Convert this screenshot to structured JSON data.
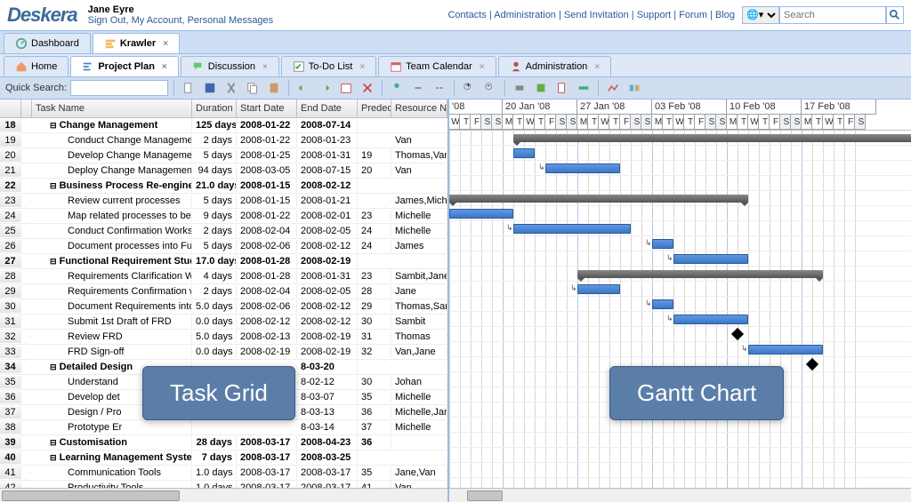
{
  "header": {
    "logo": "Deskera",
    "user_name": "Jane Eyre",
    "user_links": [
      "Sign Out",
      "My Account",
      "Personal Messages"
    ],
    "top_links": [
      "Contacts",
      "Administration",
      "Send Invitation",
      "Support",
      "Forum",
      "Blog"
    ],
    "search_placeholder": "Search"
  },
  "module_tabs": [
    {
      "label": "Dashboard",
      "active": false
    },
    {
      "label": "Krawler",
      "active": true
    }
  ],
  "sub_tabs": [
    {
      "label": "Home"
    },
    {
      "label": "Project Plan",
      "active": true
    },
    {
      "label": "Discussion"
    },
    {
      "label": "To-Do List"
    },
    {
      "label": "Team Calendar"
    },
    {
      "label": "Administration"
    }
  ],
  "quick_search_label": "Quick Search:",
  "grid_headers": {
    "task": "Task Name",
    "duration": "Duration",
    "start": "Start Date",
    "end": "End Date",
    "pred": "Predec",
    "res": "Resource Names"
  },
  "tasks": [
    {
      "n": 18,
      "lvl": 1,
      "sum": true,
      "name": "Change Management",
      "dur": "125 days",
      "s": "2008-01-22",
      "e": "2008-07-14",
      "p": "",
      "r": ""
    },
    {
      "n": 19,
      "lvl": 2,
      "name": "Conduct Change Management Plan",
      "dur": "2 days",
      "s": "2008-01-22",
      "e": "2008-01-23",
      "p": "",
      "r": "Van"
    },
    {
      "n": 20,
      "lvl": 2,
      "name": "Develop Change Management Plan",
      "dur": "5 days",
      "s": "2008-01-25",
      "e": "2008-01-31",
      "p": "19",
      "r": "Thomas,Van"
    },
    {
      "n": 21,
      "lvl": 2,
      "name": "Deploy Change Management Act",
      "dur": "94 days",
      "s": "2008-03-05",
      "e": "2008-07-15",
      "p": "20",
      "r": "Van"
    },
    {
      "n": 22,
      "lvl": 1,
      "sum": true,
      "name": "Business Process Re-engineering",
      "dur": "21.0 days",
      "s": "2008-01-15",
      "e": "2008-02-12",
      "p": "",
      "r": ""
    },
    {
      "n": 23,
      "lvl": 2,
      "name": "Review current processes",
      "dur": "5 days",
      "s": "2008-01-15",
      "e": "2008-01-21",
      "p": "",
      "r": "James,Michelle"
    },
    {
      "n": 24,
      "lvl": 2,
      "name": "Map related processes to best p",
      "dur": "9 days",
      "s": "2008-01-22",
      "e": "2008-02-01",
      "p": "23",
      "r": "Michelle"
    },
    {
      "n": 25,
      "lvl": 2,
      "name": "Conduct Confirmation Workshop",
      "dur": "2 days",
      "s": "2008-02-04",
      "e": "2008-02-05",
      "p": "24",
      "r": "Michelle"
    },
    {
      "n": 26,
      "lvl": 2,
      "name": "Document processes into Functi",
      "dur": "5 days",
      "s": "2008-02-06",
      "e": "2008-02-12",
      "p": "24",
      "r": "James"
    },
    {
      "n": 27,
      "lvl": 1,
      "sum": true,
      "name": "Functional Requirement Study",
      "dur": "17.0 days",
      "s": "2008-01-28",
      "e": "2008-02-19",
      "p": "",
      "r": ""
    },
    {
      "n": 28,
      "lvl": 2,
      "name": "Requirements Clarification Works",
      "dur": "4 days",
      "s": "2008-01-28",
      "e": "2008-01-31",
      "p": "23",
      "r": "Sambit,Jane"
    },
    {
      "n": 29,
      "lvl": 2,
      "name": "Requirements Confirmation work",
      "dur": "2 days",
      "s": "2008-02-04",
      "e": "2008-02-05",
      "p": "28",
      "r": "Jane"
    },
    {
      "n": 30,
      "lvl": 2,
      "name": "Document Requirements into FRD",
      "dur": "5.0 days",
      "s": "2008-02-06",
      "e": "2008-02-12",
      "p": "29",
      "r": "Thomas,Sambit"
    },
    {
      "n": 31,
      "lvl": 2,
      "name": "Submit 1st Draft of FRD",
      "dur": "0.0 days",
      "s": "2008-02-12",
      "e": "2008-02-12",
      "p": "30",
      "r": "Sambit"
    },
    {
      "n": 32,
      "lvl": 2,
      "name": "Review FRD",
      "dur": "5.0 days",
      "s": "2008-02-13",
      "e": "2008-02-19",
      "p": "31",
      "r": "Thomas"
    },
    {
      "n": 33,
      "lvl": 2,
      "name": "FRD Sign-off",
      "dur": "0.0 days",
      "s": "2008-02-19",
      "e": "2008-02-19",
      "p": "32",
      "r": "Van,Jane"
    },
    {
      "n": 34,
      "lvl": 1,
      "sum": true,
      "name": "Detailed Design",
      "dur": "",
      "s": "",
      "e": "8-03-20",
      "p": "",
      "r": ""
    },
    {
      "n": 35,
      "lvl": 2,
      "name": "Understand",
      "dur": "",
      "s": "",
      "e": "8-02-12",
      "p": "30",
      "r": "Johan"
    },
    {
      "n": 36,
      "lvl": 2,
      "name": "Develop det",
      "dur": "",
      "s": "",
      "e": "8-03-07",
      "p": "35",
      "r": "Michelle"
    },
    {
      "n": 37,
      "lvl": 2,
      "name": "Design / Pro",
      "dur": "",
      "s": "",
      "e": "8-03-13",
      "p": "36",
      "r": "Michelle,Jane"
    },
    {
      "n": 38,
      "lvl": 2,
      "name": "Prototype Er",
      "dur": "",
      "s": "",
      "e": "8-03-14",
      "p": "37",
      "r": "Michelle"
    },
    {
      "n": 39,
      "lvl": 1,
      "sum": true,
      "name": "Customisation",
      "dur": "28 days",
      "s": "2008-03-17",
      "e": "2008-04-23",
      "p": "36",
      "r": ""
    },
    {
      "n": 40,
      "lvl": 1,
      "sum": true,
      "name": "Learning Management System",
      "dur": "7 days",
      "s": "2008-03-17",
      "e": "2008-03-25",
      "p": "",
      "r": ""
    },
    {
      "n": 41,
      "lvl": 2,
      "name": "Communication Tools",
      "dur": "1.0 days",
      "s": "2008-03-17",
      "e": "2008-03-17",
      "p": "35",
      "r": "Jane,Van"
    },
    {
      "n": 42,
      "lvl": 2,
      "name": "Productivity Tools",
      "dur": "1.0 days",
      "s": "2008-03-17",
      "e": "2008-03-17",
      "p": "41",
      "r": "Van"
    }
  ],
  "gantt_week_labels": [
    "'08",
    "20 Jan '08",
    "27 Jan '08",
    "03 Feb '08",
    "10 Feb '08",
    "17 Feb '08"
  ],
  "gantt_days": [
    "W",
    "T",
    "F",
    "S",
    "S",
    "M",
    "T",
    "W",
    "T",
    "F",
    "S",
    "S",
    "M",
    "T",
    "W",
    "T",
    "F",
    "S",
    "S",
    "M",
    "T",
    "W",
    "T",
    "F",
    "S",
    "S",
    "M",
    "T",
    "W",
    "T",
    "F",
    "S",
    "S",
    "M",
    "T",
    "W",
    "T",
    "F",
    "S"
  ],
  "overlays": {
    "grid": "Task Grid",
    "gantt": "Gantt Chart"
  }
}
